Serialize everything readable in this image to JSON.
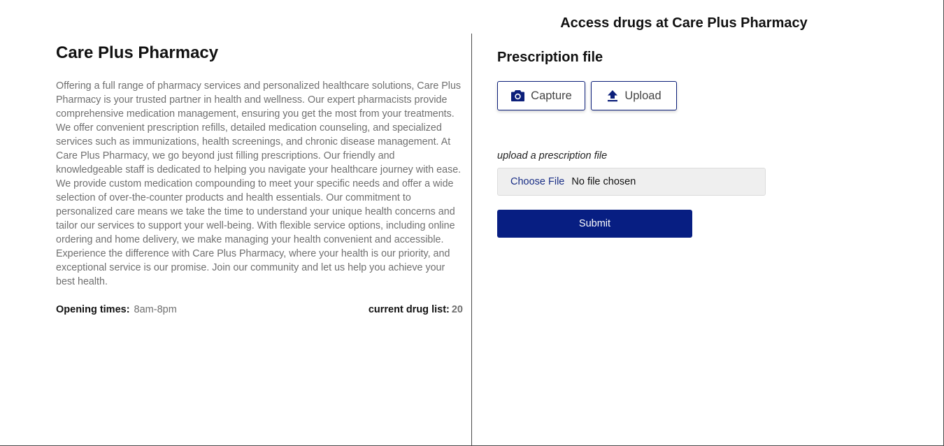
{
  "header": {
    "title": "Access drugs at Care Plus Pharmacy"
  },
  "pharmacy": {
    "name": "Care Plus Pharmacy",
    "description": "Offering a full range of pharmacy services and personalized healthcare solutions, Care Plus Pharmacy is your trusted partner in health and wellness. Our expert pharmacists provide comprehensive medication management, ensuring you get the most from your treatments. We offer convenient prescription refills, detailed medication counseling, and specialized services such as immunizations, health screenings, and chronic disease management. At Care Plus Pharmacy, we go beyond just filling prescriptions. Our friendly and knowledgeable staff is dedicated to helping you navigate your healthcare journey with ease. We provide custom medication compounding to meet your specific needs and offer a wide selection of over-the-counter products and health essentials. Our commitment to personalized care means we take the time to understand your unique health concerns and tailor our services to support your well-being. With flexible service options, including online ordering and home delivery, we make managing your health convenient and accessible. Experience the difference with Care Plus Pharmacy, where your health is our priority, and exceptional service is our promise. Join our community and let us help you achieve your best health.",
    "opening_times_label": "Opening times:",
    "opening_times_value": "8am-8pm",
    "drug_list_label": "current drug list:",
    "drug_list_count": "20"
  },
  "prescription": {
    "title": "Prescription file",
    "capture_label": "Capture",
    "upload_label": "Upload",
    "file_label": "upload a prescription file",
    "choose_file_label": "Choose File",
    "no_file_label": "No file chosen",
    "submit_label": "Submit"
  },
  "icons": {
    "capture": "camera-icon",
    "upload": "upload-icon"
  },
  "colors": {
    "accent": "#071e82",
    "button_border": "#0c1f7a",
    "muted_text": "#6f6f6f"
  }
}
